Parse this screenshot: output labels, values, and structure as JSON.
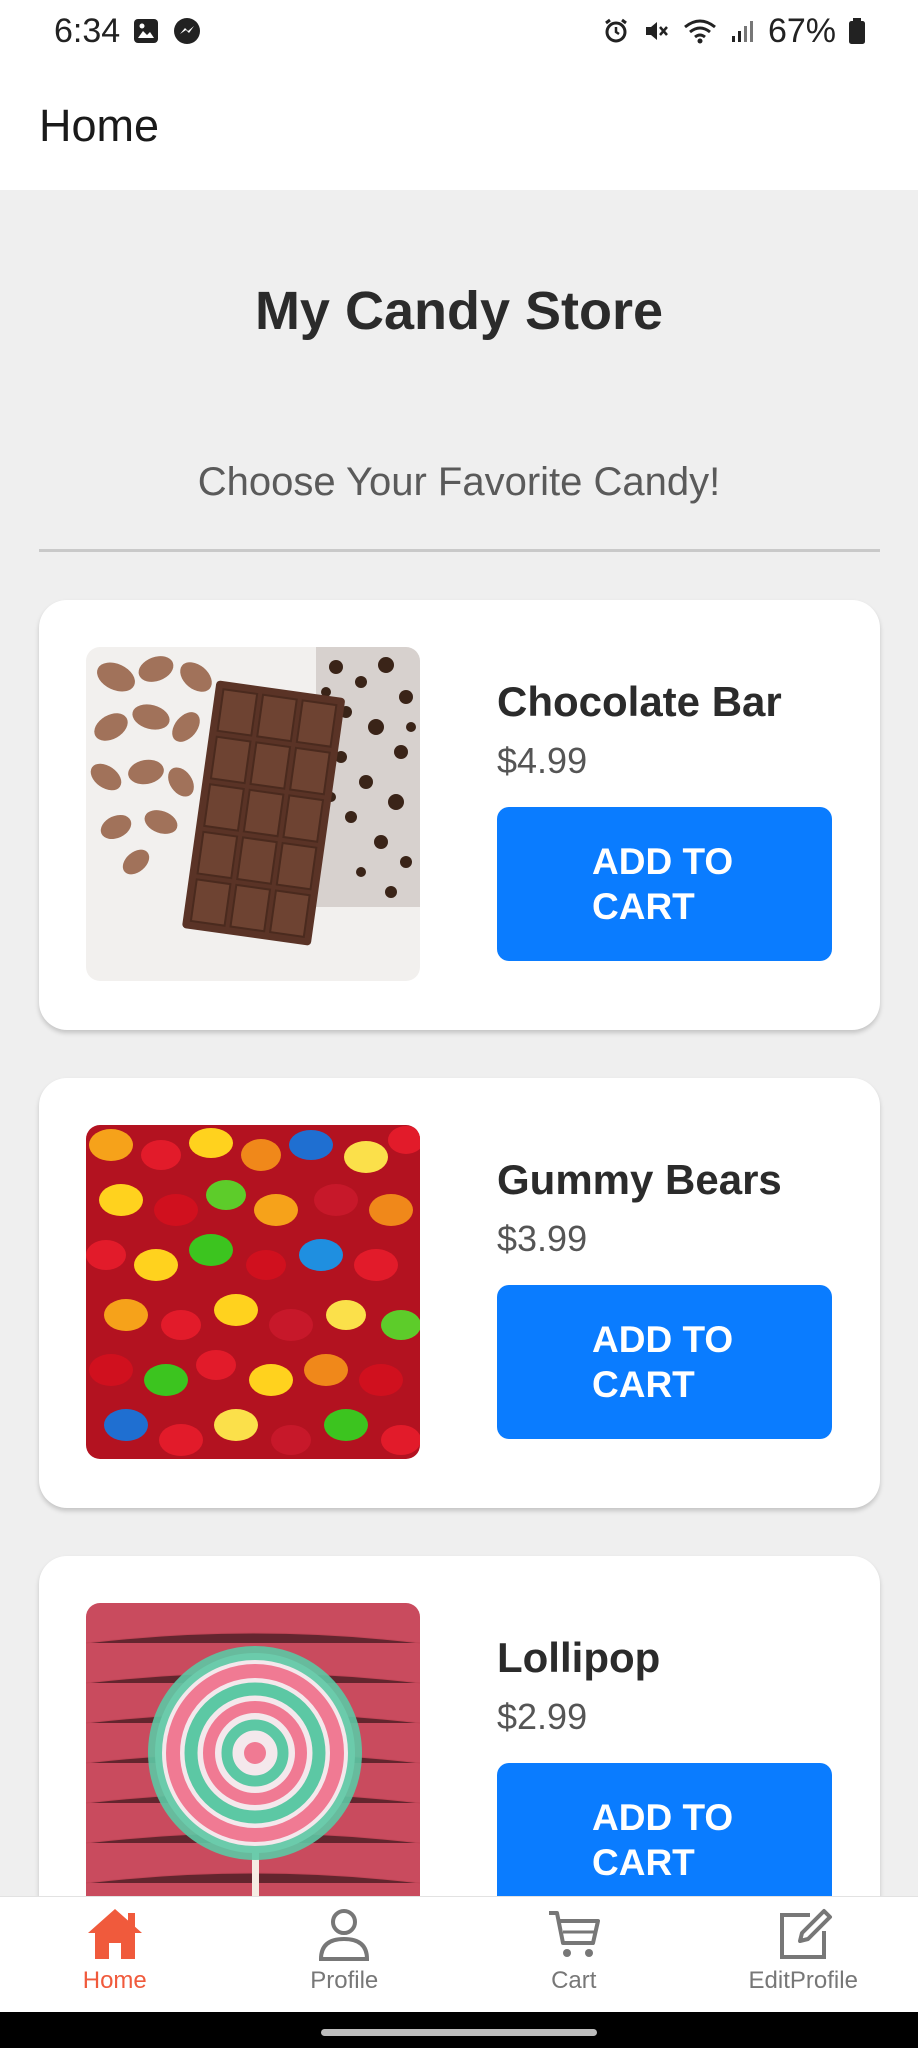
{
  "status_bar": {
    "time": "6:34",
    "battery": "67%",
    "icons_left": [
      "image-icon",
      "messenger-icon"
    ],
    "icons_right": [
      "alarm-icon",
      "mute-icon",
      "wifi-icon",
      "signal-icon",
      "battery-icon"
    ]
  },
  "header": {
    "title": "Home"
  },
  "store": {
    "title": "My Candy Store",
    "subtitle": "Choose Your Favorite Candy!"
  },
  "products": [
    {
      "name": "Chocolate Bar",
      "price": "$4.99",
      "button": "ADD TO CART",
      "image": "chocolate-bar-image"
    },
    {
      "name": "Gummy Bears",
      "price": "$3.99",
      "button": "ADD TO CART",
      "image": "gummy-bears-image"
    },
    {
      "name": "Lollipop",
      "price": "$2.99",
      "button": "ADD TO CART",
      "image": "lollipop-image"
    }
  ],
  "bottom_nav": {
    "items": [
      {
        "label": "Home",
        "icon": "home-icon",
        "active": true
      },
      {
        "label": "Profile",
        "icon": "profile-icon",
        "active": false
      },
      {
        "label": "Cart",
        "icon": "cart-icon",
        "active": false
      },
      {
        "label": "EditProfile",
        "icon": "edit-icon",
        "active": false
      }
    ]
  },
  "colors": {
    "accent_button": "#0a7cff",
    "active_nav": "#f05a3c",
    "background": "#efefef"
  }
}
